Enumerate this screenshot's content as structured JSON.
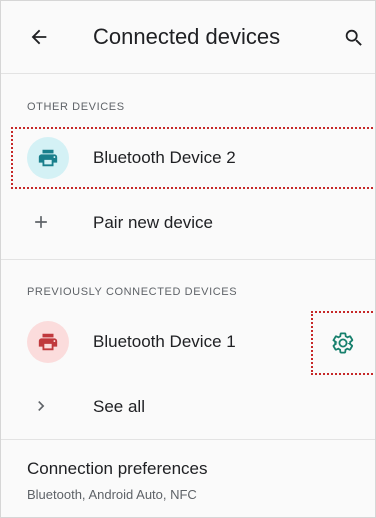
{
  "appbar": {
    "title": "Connected devices",
    "back_icon": "arrow-back-icon",
    "search_icon": "search-icon"
  },
  "other_devices": {
    "header": "OTHER DEVICES",
    "devices": [
      {
        "name": "Bluetooth Device 2",
        "icon": "printer-icon",
        "icon_color": "#1a7f8c",
        "icon_bg": "#d4f1f5"
      }
    ],
    "pair_new": {
      "label": "Pair new device",
      "icon": "plus-icon"
    }
  },
  "previously_connected": {
    "header": "PREVIOUSLY CONNECTED DEVICES",
    "devices": [
      {
        "name": "Bluetooth Device 1",
        "icon": "printer-icon",
        "icon_color": "#c0393d",
        "icon_bg": "#fbdcdc",
        "settings_icon": "gear-icon",
        "settings_color": "#17806d"
      }
    ],
    "see_all": {
      "label": "See all",
      "icon": "chevron-right-icon"
    }
  },
  "connection_preferences": {
    "title": "Connection preferences",
    "subtitle": "Bluetooth, Android Auto, NFC"
  },
  "highlight_color": "#c62828"
}
